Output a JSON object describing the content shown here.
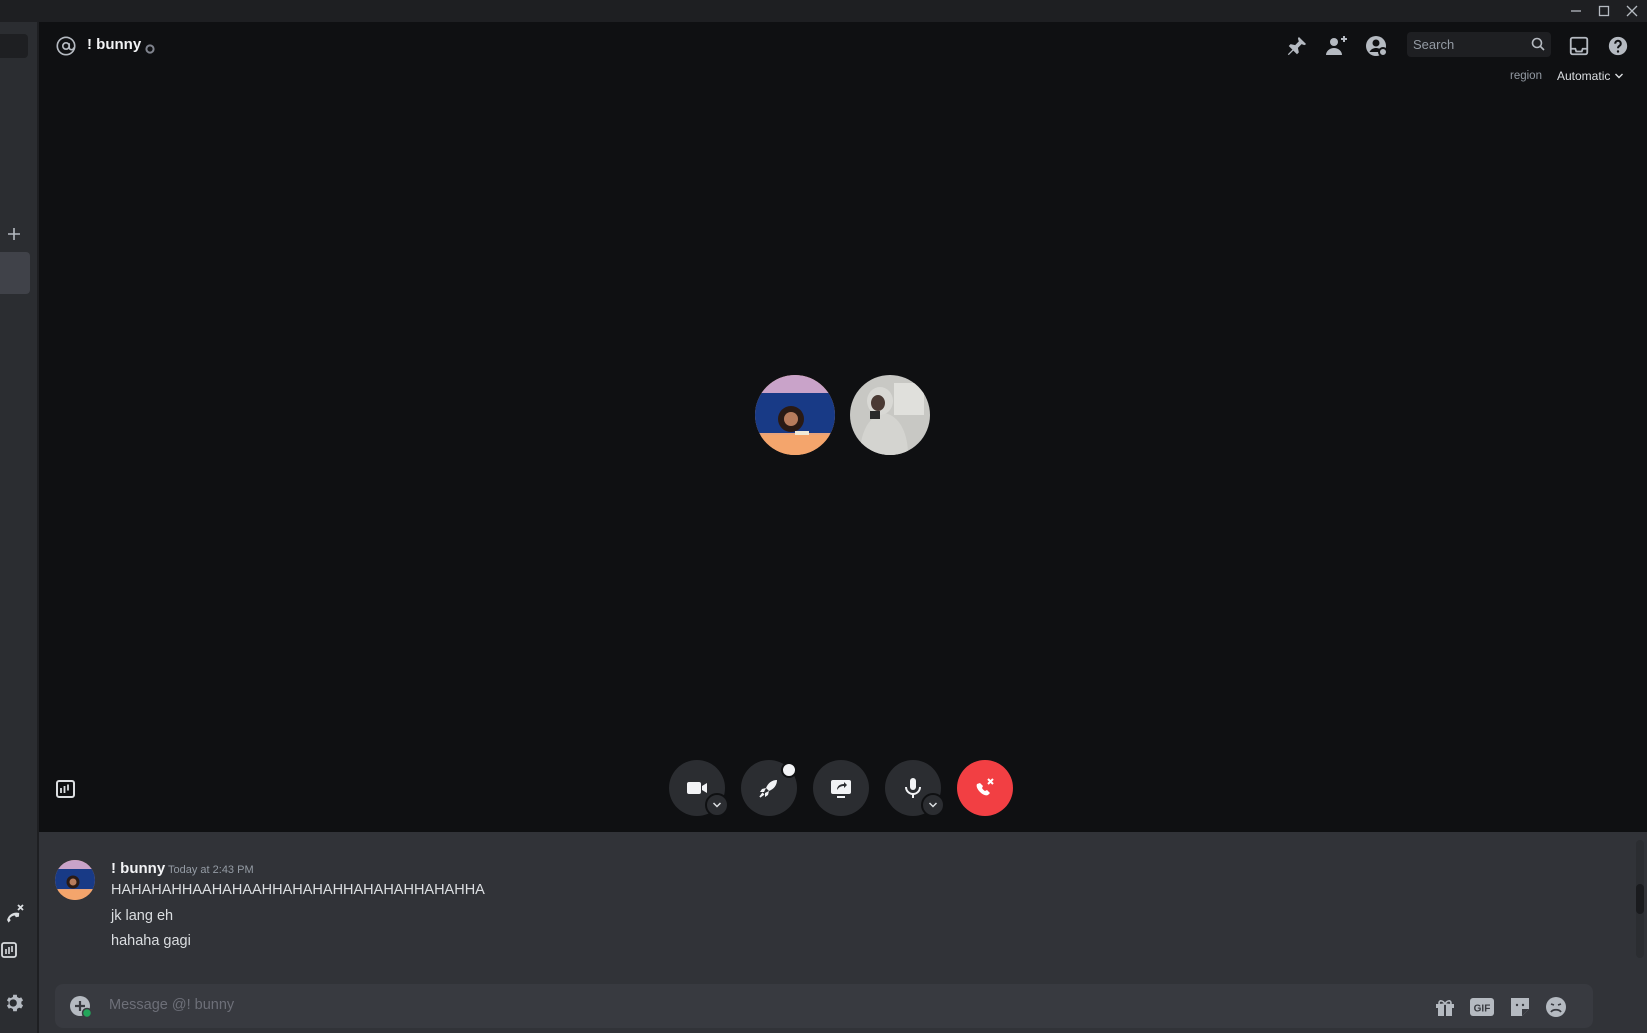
{
  "window": {
    "controls": [
      "minimize",
      "maximize",
      "close"
    ]
  },
  "header": {
    "channel_name": "! bunny",
    "search_placeholder": "Search",
    "region_label": "region",
    "region_value": "Automatic"
  },
  "messages": {
    "author": "! bunny",
    "timestamp": "Today at 2:43 PM",
    "lines": [
      "HAHAHAHHAAHAHAAHHAHAHAHHAHAHAHHAHAHHA",
      "jk lang eh",
      "hahaha gagi"
    ]
  },
  "composer": {
    "placeholder": "Message @! bunny"
  },
  "colors": {
    "call_bg": "#0f1012",
    "chat_bg": "#313338",
    "hangup_red": "#f23f43",
    "control_bg": "#2b2d31",
    "online_green": "#23a55a"
  },
  "icons": [
    "at-icon",
    "status-idle-icon",
    "pin-icon",
    "add-friend-icon",
    "user-profile-icon",
    "search-icon",
    "inbox-icon",
    "help-icon",
    "camera-icon",
    "activity-rocket-icon",
    "screen-share-icon",
    "microphone-icon",
    "hang-up-icon",
    "chevron-down-icon",
    "activity-panel-icon",
    "plus-icon",
    "gear-icon",
    "gift-icon",
    "gif-icon",
    "sticker-icon",
    "emoji-icon"
  ]
}
